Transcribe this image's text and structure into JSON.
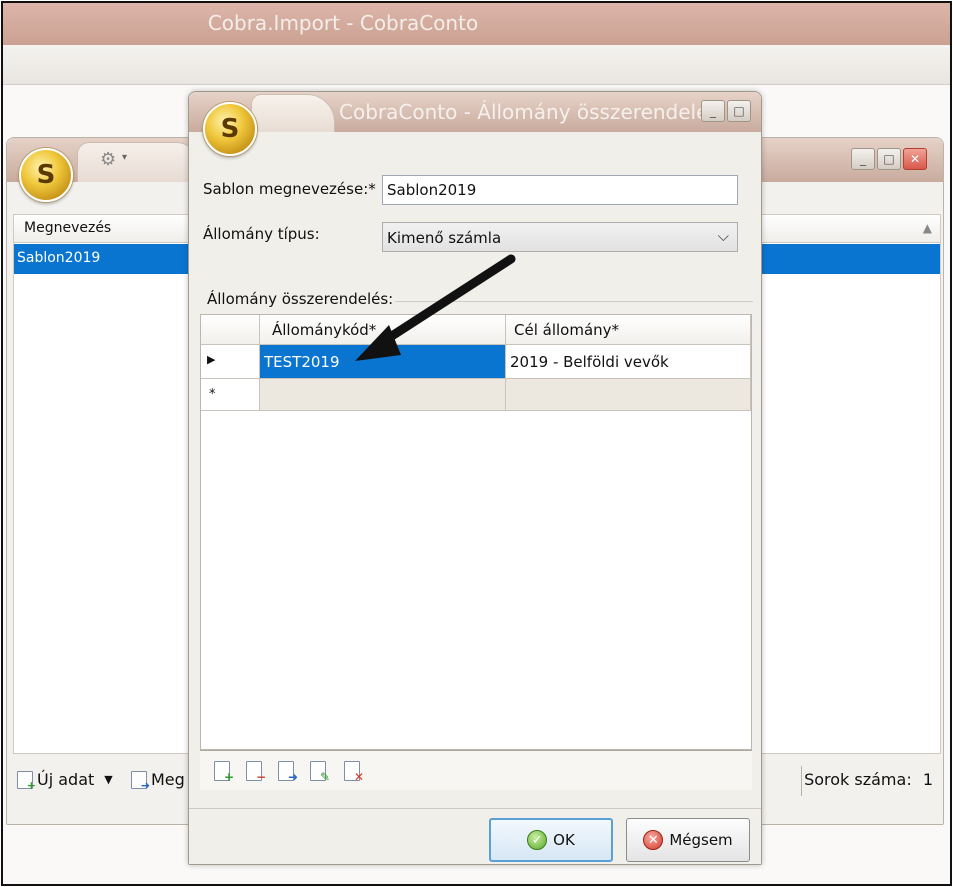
{
  "app": {
    "title": "Cobra.Import - CobraConto"
  },
  "list_window": {
    "column_header": "Megnevezés",
    "rows": [
      "Sablon2019"
    ],
    "footer": {
      "new_label": "Új adat",
      "edit_label": "Meg",
      "row_count_label": "Sorok száma:",
      "row_count_value": "1"
    }
  },
  "dialog": {
    "title": "CobraConto - Állomány összerendelés",
    "template_name_label": "Sablon megnevezése:*",
    "template_name_value": "Sablon2019",
    "file_type_label": "Állomány típus:",
    "file_type_value": "Kimenő számla",
    "group_label": "Állomány összerendelés:",
    "grid": {
      "columns": [
        "Állománykód*",
        "Cél állomány*"
      ],
      "rows": [
        [
          "TEST2019",
          "2019 - Belföldi vevők"
        ]
      ],
      "new_row_marker": "*"
    },
    "buttons": {
      "ok": "OK",
      "cancel": "Mégsem"
    }
  },
  "colors": {
    "selection": "#0a75d1",
    "titlebar": "#c9ab9e",
    "dialog_bg": "#f1efea"
  },
  "icons": {
    "logo": "cobra-logo-icon",
    "settings": "gear-icon",
    "grid_tools": [
      "add-row-icon",
      "delete-row-icon",
      "export-icon",
      "edit-icon",
      "clear-icon"
    ]
  }
}
